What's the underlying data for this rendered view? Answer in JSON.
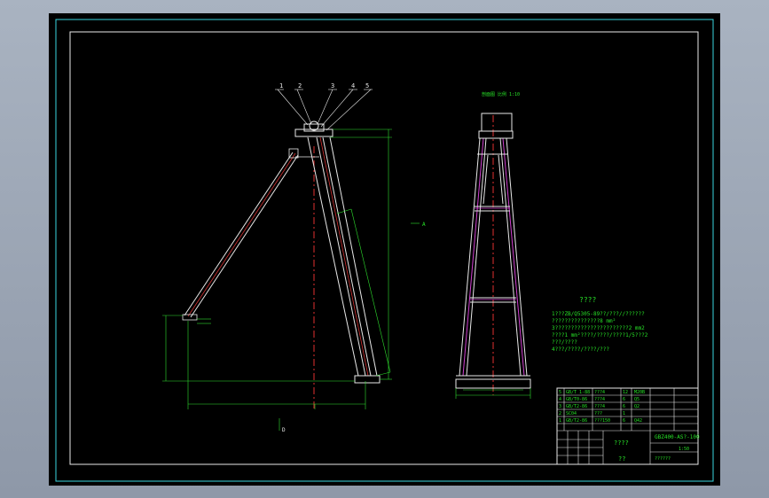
{
  "balloons": [
    "1",
    "2",
    "3",
    "4",
    "5"
  ],
  "dims": {
    "a_mark": "A",
    "b_mark": "D",
    "side_label": "Ⅱ",
    "right_top_label": "剖面图 比例 1:10"
  },
  "notes": {
    "title": "????",
    "lines": [
      "1???ZB/Q5305-89??/???//??????",
      "???????????????8 mm²",
      "3???????????????????????2 mm2",
      "????1 mm²????/????/????1/5???2",
      "???/????",
      "4???/????/????/???"
    ]
  },
  "bom": {
    "rows": [
      {
        "no": "5",
        "code": "GB/T 1-88",
        "name": "???4",
        "qty": "12",
        "mat": "M20B"
      },
      {
        "no": "4",
        "code": "GB/T0-86",
        "name": "???4",
        "qty": "6",
        "mat": "Q5"
      },
      {
        "no": "3",
        "code": "GB/T2-86",
        "name": "???4",
        "qty": "6",
        "mat": "Q2"
      },
      {
        "no": "2",
        "code": "SC04",
        "name": "???",
        "qty": "1",
        "mat": ""
      },
      {
        "no": "1",
        "code": "GB/T2-86",
        "name": "???150",
        "qty": "6",
        "mat": "Q42"
      }
    ],
    "drawing_no": "GBZ400-AS?-100",
    "part_title": "????",
    "scale": "1:50",
    "sheet_label": "??",
    "company": "??????"
  }
}
